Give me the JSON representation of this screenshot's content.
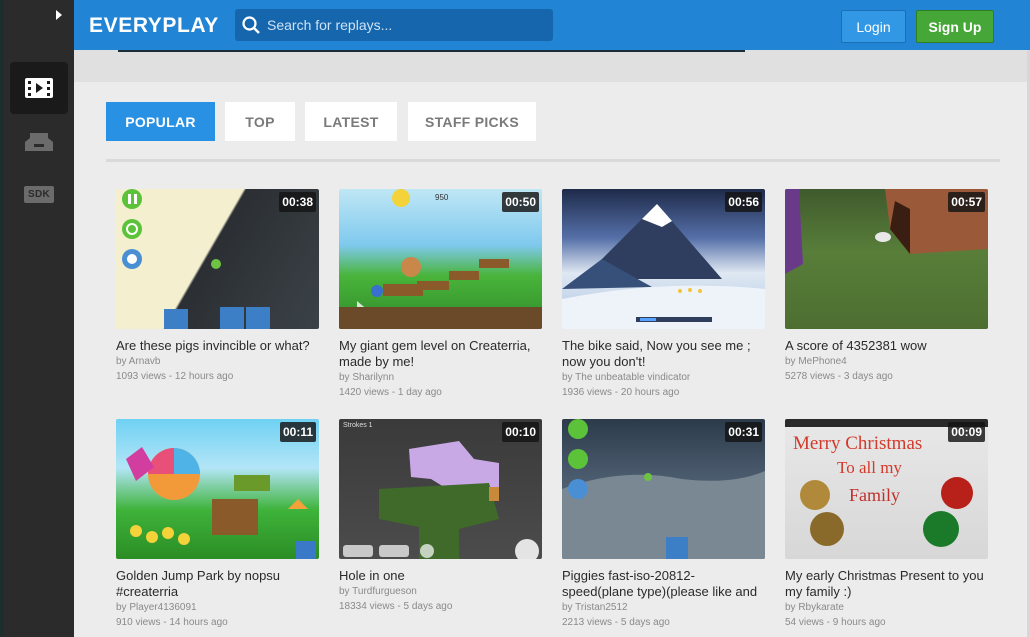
{
  "header": {
    "logo": "EVERYPLAY",
    "search_placeholder": "Search for replays...",
    "login_label": "Login",
    "signup_label": "Sign Up"
  },
  "sidebar": {
    "sdk_label": "SDK"
  },
  "tabs": [
    {
      "label": "POPULAR",
      "active": true
    },
    {
      "label": "TOP",
      "active": false
    },
    {
      "label": "LATEST",
      "active": false
    },
    {
      "label": "STAFF PICKS",
      "active": false
    }
  ],
  "videos": [
    {
      "title": "Are these pigs invincible or what?",
      "author": "by Arnavb",
      "meta": "1093 views - 12 hours ago",
      "duration": "00:38"
    },
    {
      "title": "My giant gem level on Createrria, made by me!",
      "author": "by Sharilynn",
      "meta": "1420 views - 1 day ago",
      "duration": "00:50"
    },
    {
      "title": "The bike said, Now you see me ; now you don't!",
      "author": "by The unbeatable vindicator",
      "meta": "1936 views - 20 hours ago",
      "duration": "00:56"
    },
    {
      "title": "A score of 4352381 wow",
      "author": "by MePhone4",
      "meta": "5278 views - 3 days ago",
      "duration": "00:57"
    },
    {
      "title": "Golden Jump Park by nopsu #createrria",
      "author": "by Player4136091",
      "meta": "910 views - 14 hours ago",
      "duration": "00:11"
    },
    {
      "title": "Hole in one",
      "author": "by Turdfurgueson",
      "meta": "18334 views - 5 days ago",
      "duration": "00:10"
    },
    {
      "title": "Piggies fast-iso-20812-speed(plane type)(please like and",
      "author": "by Tristan2512",
      "meta": "2213 views - 5 days ago",
      "duration": "00:31"
    },
    {
      "title": "My early Christmas Present to you my family :)",
      "author": "by Rbykarate",
      "meta": "54 views - 9 hours ago",
      "duration": "00:09"
    }
  ],
  "thumb_text": {
    "t2_score": "950",
    "t6_strokes": "Strokes 1",
    "t8_line1": "Merry Christmas",
    "t8_line2": "To all my",
    "t8_line3": "Family"
  }
}
